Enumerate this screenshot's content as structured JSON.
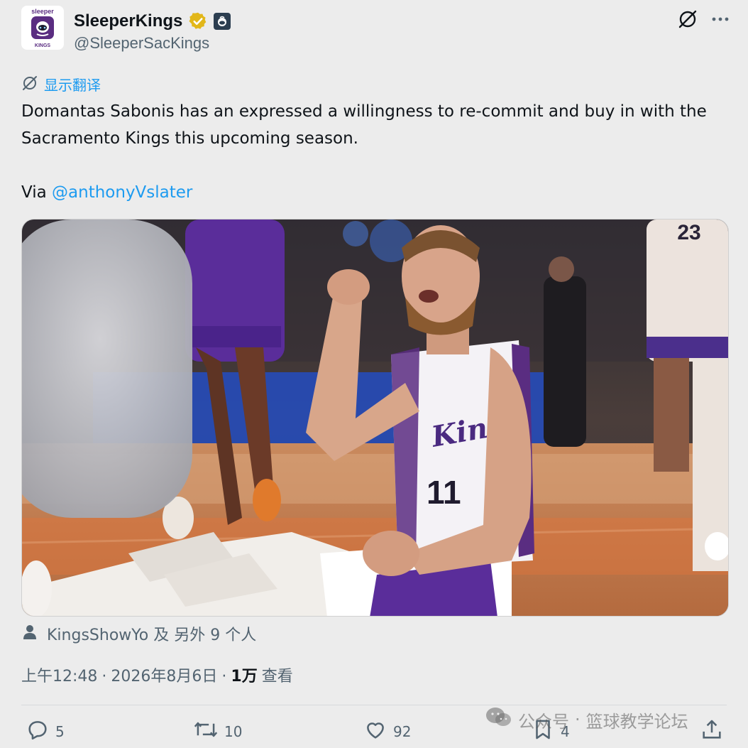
{
  "author": {
    "display_name": "SleeperKings",
    "handle": "@SleeperSacKings",
    "avatar_text_top": "sleeper",
    "avatar_text_bottom": "KINGS"
  },
  "icons": {
    "grok": "slashed-circle-icon",
    "more": "more-icon",
    "translate": "translate-icon",
    "person": "person-icon",
    "reply": "reply-icon",
    "retweet": "retweet-icon",
    "like": "like-icon",
    "bookmark": "bookmark-icon",
    "share": "share-icon",
    "wechat": "wechat-icon"
  },
  "translate_label": "显示翻译",
  "tweet": {
    "line1": "Domantas Sabonis has an expressed a willingness to re-commit and buy in with the",
    "line2": "Sacramento Kings this upcoming season.",
    "via_prefix": "Via ",
    "via_mention": "@anthonyVslater"
  },
  "media": {
    "jersey_number": "11",
    "jersey_text": "Kings",
    "bg_jersey_number": "23"
  },
  "liked_by": "KingsShowYo 及 另外 9 个人",
  "meta": {
    "time": "上午12:48",
    "separator": "·",
    "date": "2026年8月6日",
    "views_count": "1万",
    "views_label": "查看"
  },
  "actions": {
    "replies": "5",
    "retweets": "10",
    "likes": "92",
    "bookmarks": "4"
  },
  "watermark": {
    "prefix": "公众号",
    "dot": "·",
    "name": "篮球教学论坛"
  },
  "colors": {
    "accent": "#1d9bf0",
    "kings_purple": "#5a2d81",
    "verified_gold": "#e2b719",
    "court_orange": "#d9743e"
  }
}
